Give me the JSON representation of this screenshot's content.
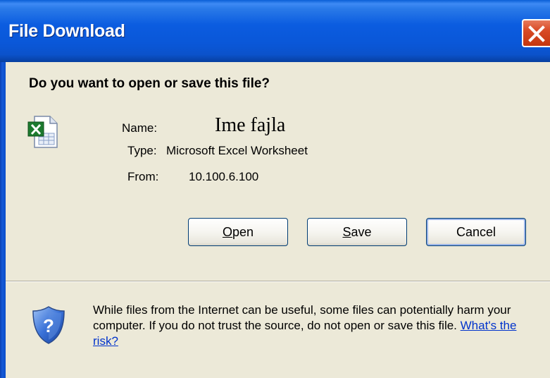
{
  "window": {
    "title": "File Download"
  },
  "dialog": {
    "question": "Do you want to open or save this file?",
    "fields": {
      "name_label": "Name:",
      "name_value": "Ime fajla",
      "type_label": "Type:",
      "type_value": "Microsoft Excel Worksheet",
      "from_label": "From:",
      "from_value": "10.100.6.100"
    },
    "buttons": {
      "open_mnemonic": "O",
      "open_rest": "pen",
      "save_mnemonic": "S",
      "save_rest": "ave",
      "cancel": "Cancel"
    },
    "warning": {
      "text": "While files from the Internet can be useful, some files can potentially harm your computer. If you do not trust the source, do not open or save this file. ",
      "link": "What's the risk?"
    }
  },
  "icons": {
    "file": "excel-file-icon",
    "security": "security-shield-icon",
    "close": "close-icon"
  },
  "colors": {
    "titlebar": "#0b5ce0",
    "close": "#d84a25",
    "dialog_bg": "#ece9d8",
    "button_border": "#003c74",
    "link": "#0033cc"
  }
}
